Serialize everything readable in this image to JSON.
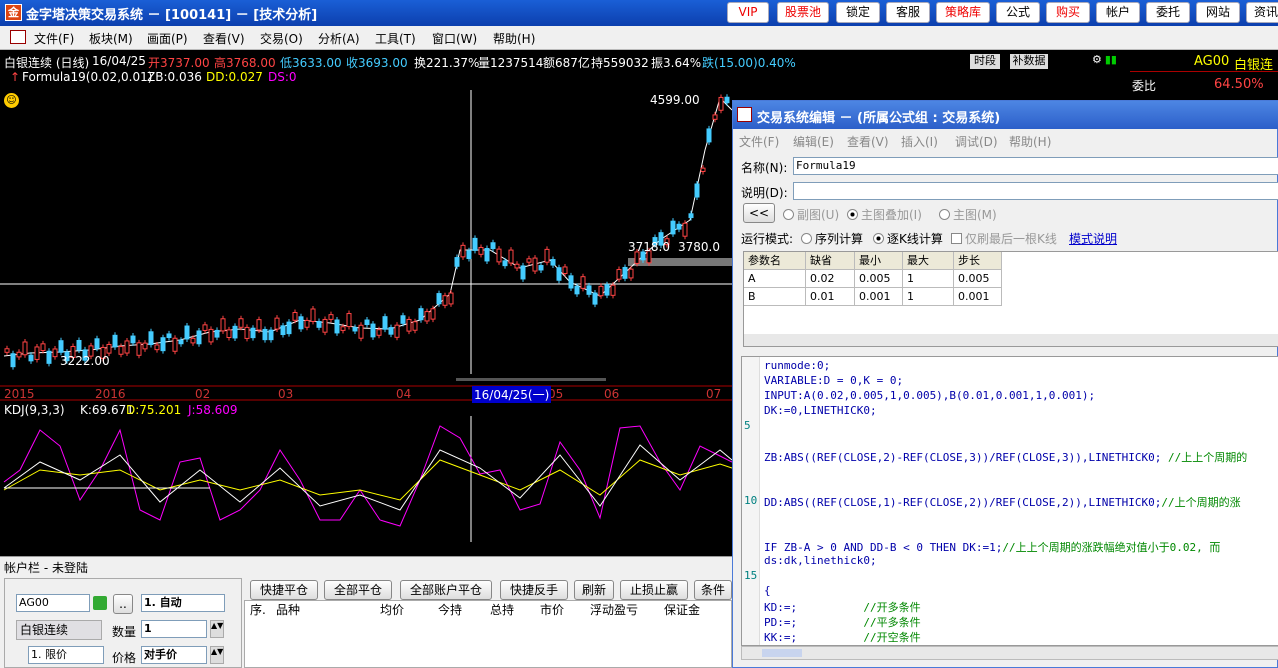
{
  "window": {
    "title": "金字塔决策交易系统 － [100141] － [技术分析]",
    "icon": "app-logo-icon"
  },
  "toolbar": [
    "VIP",
    "股票池",
    "锁定",
    "客服",
    "策略库",
    "公式",
    "购买",
    "帐户",
    "委托",
    "网站",
    "资讯"
  ],
  "menu": [
    "文件(F)",
    "板块(M)",
    "画面(P)",
    "查看(V)",
    "交易(O)",
    "分析(A)",
    "工具(T)",
    "窗口(W)",
    "帮助(H)"
  ],
  "chart": {
    "symbol": "白银连续 (日线)",
    "date": "16/04/25",
    "open": "开3737.00",
    "high": "高3768.00",
    "low": "低3633.00",
    "close": "收3693.00",
    "turnover": "换221.37%",
    "volume": "量1237514",
    "amount": "额687亿",
    "oi": "持559032",
    "amp": "振3.64%",
    "change": "跌(15.00)0.40%",
    "formula": "Formula19(0.02,0.01)",
    "zb": "ZB:0.036",
    "dd": "DD:0.027",
    "ds": "DS:0",
    "btn_time": "时段",
    "btn_supp": "补数据",
    "price_high": "4599.00",
    "price_low": "3222.00",
    "price_mid1": "3718.0",
    "price_mid2": "3780.0",
    "xaxis": [
      "2015",
      "2016",
      "02",
      "03",
      "04",
      "05",
      "06",
      "07"
    ],
    "cursor_date": "16/04/25(一)",
    "kdj": "KDJ(9,3,3)",
    "k": "K:69.671",
    "d": "D:75.201",
    "j": "J:58.609"
  },
  "right_panel": {
    "code": "AG00",
    "name": "白银连",
    "weibi_label": "委比",
    "weibi": "64.50%"
  },
  "editor": {
    "title": "交易系统编辑 － (所属公式组 : 交易系统)",
    "menu": [
      "文件(F)",
      "编辑(E)",
      "查看(V)",
      "插入(I)",
      "调试(D)",
      "帮助(H)"
    ],
    "name_label": "名称(N):",
    "name_value": "Formula19",
    "desc_label": "说明(D):",
    "desc_value": "",
    "back_btn": "<<",
    "chart_sub": "副图(U)",
    "chart_overlay": "主图叠加(I)",
    "chart_main": "主图(M)",
    "run_label": "运行模式:",
    "run_seq": "序列计算",
    "run_bar": "逐K线计算",
    "run_last": "仅刷最后一根K线",
    "run_help": "模式说明",
    "param_headers": [
      "参数名",
      "缺省",
      "最小",
      "最大",
      "步长"
    ],
    "params": [
      [
        "A",
        "0.02",
        "0.005",
        "1",
        "0.005"
      ],
      [
        "B",
        "0.01",
        "0.001",
        "1",
        "0.001"
      ]
    ],
    "code_lines": [
      {
        "n": "",
        "t": "runmode:0;"
      },
      {
        "n": "",
        "t": "VARIABLE:D = 0,K = 0;"
      },
      {
        "n": "",
        "t": "INPUT:A(0.02,0.005,1,0.005),B(0.01,0.001,1,0.001);"
      },
      {
        "n": "",
        "t": "DK:=0,LINETHICK0;"
      },
      {
        "n": "5",
        "t": ""
      },
      {
        "n": "",
        "t": ""
      },
      {
        "n": "",
        "t": "ZB:ABS((REF(CLOSE,2)-REF(CLOSE,3))/REF(CLOSE,3)),LINETHICK0; //上上个周期的"
      },
      {
        "n": "",
        "t": ""
      },
      {
        "n": "",
        "t": ""
      },
      {
        "n": "10",
        "t": "DD:ABS((REF(CLOSE,1)-REF(CLOSE,2))/REF(CLOSE,2)),LINETHICK0;//上个周期的涨"
      },
      {
        "n": "",
        "t": ""
      },
      {
        "n": "",
        "t": ""
      },
      {
        "n": "",
        "t": "IF ZB-A > 0 AND DD-B < 0 THEN DK:=1;//上上个周期的涨跌幅绝对值小于0.02, 而"
      },
      {
        "n": "",
        "t": "ds:dk,linethick0;"
      },
      {
        "n": "15",
        "t": ""
      },
      {
        "n": "",
        "t": "{"
      },
      {
        "n": "",
        "t": "KD:=;          //开多条件"
      },
      {
        "n": "",
        "t": "PD:=;          //平多条件"
      },
      {
        "n": "",
        "t": "KK:=;          //开空条件"
      }
    ]
  },
  "account": {
    "title": "帐户栏 - 未登陆",
    "code": "AG00",
    "name": "白银连续",
    "mode": "1. 自动",
    "qty_label": "数量",
    "qty": "1",
    "price_label": "价格",
    "price_type": "1. 限价",
    "price_value": "对手价",
    "buttons": [
      "快捷平仓",
      "全部平仓",
      "全部账户平仓",
      "快捷反手",
      "刷新",
      "止损止赢",
      "条件"
    ],
    "headers": [
      "序.",
      "品种",
      "均价",
      "今持",
      "总持",
      "市价",
      "浮动盈亏",
      "保证金"
    ]
  }
}
